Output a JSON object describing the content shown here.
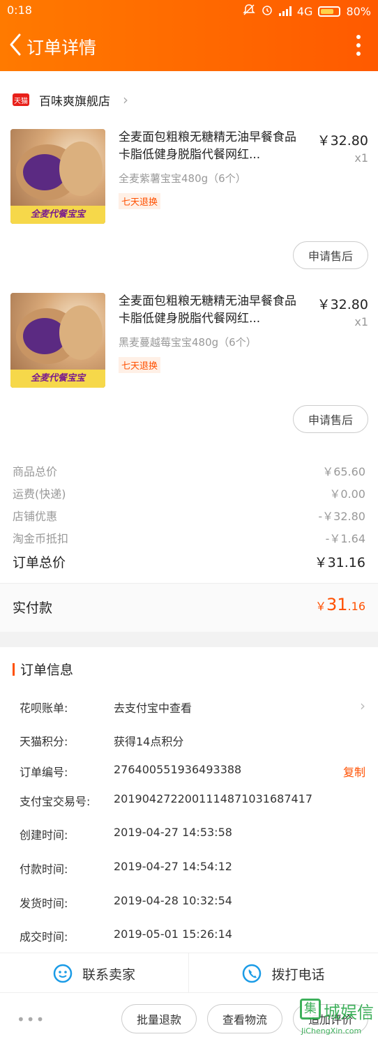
{
  "status": {
    "time": "0:18",
    "network": "4G",
    "battery": "80%"
  },
  "header": {
    "title": "订单详情"
  },
  "shop": {
    "logo_text": "天猫",
    "name": "百味爽旗舰店"
  },
  "items": [
    {
      "name": "全麦面包粗粮无糖精无油早餐食品卡脂低健身脱脂代餐网红...",
      "sku": "全麦紫薯宝宝480g（6个）",
      "tag": "七天退换",
      "price": "￥32.80",
      "qty": "x1",
      "image_banner": "全麦代餐宝宝",
      "after_sale": "申请售后"
    },
    {
      "name": "全麦面包粗粮无糖精无油早餐食品卡脂低健身脱脂代餐网红...",
      "sku": "黑麦蔓越莓宝宝480g（6个）",
      "tag": "七天退换",
      "price": "￥32.80",
      "qty": "x1",
      "image_banner": "全麦代餐宝宝",
      "after_sale": "申请售后"
    }
  ],
  "summary": [
    {
      "label": "商品总价",
      "value": "￥65.60"
    },
    {
      "label": "运费(快递)",
      "value": "￥0.00"
    },
    {
      "label": "店铺优惠",
      "value": "-￥32.80"
    },
    {
      "label": "淘金币抵扣",
      "value": "-￥1.64"
    }
  ],
  "total": {
    "label": "订单总价",
    "value": "￥31.16"
  },
  "paid": {
    "label": "实付款",
    "currency": "￥",
    "int": "31",
    "dec": ".16"
  },
  "order_info": {
    "title": "订单信息",
    "rows": [
      {
        "k": "花呗账单:",
        "v": "去支付宝中查看"
      },
      {
        "k": "天猫积分:",
        "v": "获得14点积分"
      },
      {
        "k": "订单编号:",
        "v": "276400551936493388",
        "action": "复制"
      },
      {
        "k": "支付宝交易号:",
        "v": "2019042722001114871031687417"
      },
      {
        "k": "创建时间:",
        "v": "2019-04-27 14:53:58"
      },
      {
        "k": "付款时间:",
        "v": "2019-04-27 14:54:12"
      },
      {
        "k": "发货时间:",
        "v": "2019-04-28 10:32:54"
      },
      {
        "k": "成交时间:",
        "v": "2019-05-01 15:26:14"
      }
    ]
  },
  "contact": {
    "seller": "联系卖家",
    "phone": "拨打电话"
  },
  "bottom": {
    "more": "•••",
    "refund": "批量退款",
    "logistics": "查看物流",
    "review": "追加评价"
  },
  "watermark": {
    "logo": "集",
    "text": "城娱信",
    "url": "JiChengXin.com"
  },
  "colors": {
    "accent": "#ff5000",
    "header_start": "#ff7a00",
    "header_end": "#ff5a00"
  }
}
